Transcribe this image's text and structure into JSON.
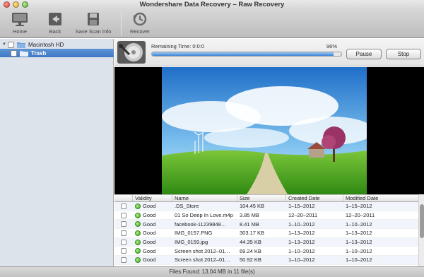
{
  "window": {
    "title": "Wondershare Data Recovery – Raw Recovery"
  },
  "toolbar": {
    "home": {
      "label": "Home",
      "icon": "monitor-icon"
    },
    "back": {
      "label": "Back",
      "icon": "back-arrow-icon"
    },
    "save_scan": {
      "label": "Save Scan Info",
      "icon": "floppy-disk-icon"
    },
    "recover": {
      "label": "Recover",
      "icon": "clock-arrow-icon"
    }
  },
  "sidebar": {
    "root": {
      "label": "Macintosh HD"
    },
    "selected": {
      "label": "Trash"
    }
  },
  "scan": {
    "remaining_label": "Remaining Time: 0:0:0",
    "percent_text": "96%",
    "progress": 0.96,
    "pause_label": "Pause",
    "stop_label": "Stop"
  },
  "table": {
    "columns": [
      "Validity",
      "Name",
      "Size",
      "Created Date",
      "Modified Date"
    ],
    "rows": [
      {
        "validity": "Good",
        "name": ".DS_Store",
        "size": "104.45 KB",
        "created": "1–15–2012",
        "modified": "1–15–2012"
      },
      {
        "validity": "Good",
        "name": "01 So Deep In Love.m4p",
        "size": "3.85 MB",
        "created": "12–20–2011",
        "modified": "12–20–2011"
      },
      {
        "validity": "Good",
        "name": "facebook-11239848…",
        "size": "8.41 MB",
        "created": "1–10–2012",
        "modified": "1–10–2012"
      },
      {
        "validity": "Good",
        "name": "IMG_0157.PNG",
        "size": "303.17 KB",
        "created": "1–13–2012",
        "modified": "1–13–2012"
      },
      {
        "validity": "Good",
        "name": "IMG_0159.jpg",
        "size": "44.35 KB",
        "created": "1–13–2012",
        "modified": "1–13–2012"
      },
      {
        "validity": "Good",
        "name": "Screen shot 2012–01…",
        "size": "69.24 KB",
        "created": "1–10–2012",
        "modified": "1–10–2012"
      },
      {
        "validity": "Good",
        "name": "Screen shot 2012–01…",
        "size": "50.92 KB",
        "created": "1–10–2012",
        "modified": "1–10–2012"
      }
    ]
  },
  "status": {
    "text": "Files Found: 13.04 MB in  11 file(s)"
  },
  "colors": {
    "selection": "#3f78c4",
    "good": "#3ea31e",
    "progress": "#3d84d8"
  }
}
